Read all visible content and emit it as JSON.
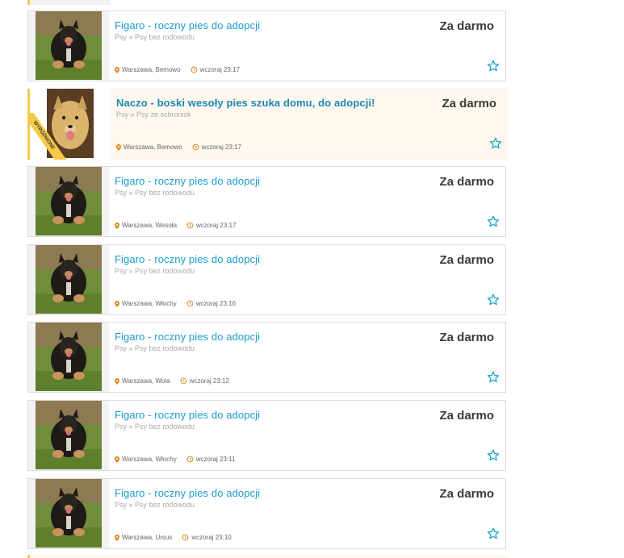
{
  "colors": {
    "title": "#1a9bd0",
    "price": "#3a3a3a",
    "accent": "#f7c948",
    "star": "#1aa5c8",
    "meta_icon": "#e08a1e"
  },
  "listings": [
    {
      "title": "Figaro - roczny pies do adopcji",
      "category": "Psy » Psy bez rodowodu",
      "price": "Za darmo",
      "location": "Warszawa, Bemowo",
      "time": "wczoraj 23:17",
      "featured": false,
      "image": "dog-photo-black-tan"
    },
    {
      "title": "Naczo - boski wesoły pies szuka domu, do adopcji!",
      "category": "Psy » Psy ze schronisk",
      "price": "Za darmo",
      "location": "Warszawa, Bemowo",
      "time": "wczoraj 23:17",
      "featured": true,
      "badge": "WYRÓŻNIONE",
      "image": "dog-photo-yellow"
    },
    {
      "title": "Figaro - roczny pies do adopcji",
      "category": "Psy » Psy bez rodowodu",
      "price": "Za darmo",
      "location": "Warszawa, Wesoła",
      "time": "wczoraj 23:17",
      "featured": false,
      "image": "dog-photo-black-tan"
    },
    {
      "title": "Figaro - roczny pies do adopcji",
      "category": "Psy » Psy bez rodowodu",
      "price": "Za darmo",
      "location": "Warszawa, Włochy",
      "time": "wczoraj 23:16",
      "featured": false,
      "image": "dog-photo-black-tan"
    },
    {
      "title": "Figaro - roczny pies do adopcji",
      "category": "Psy » Psy bez rodowodu",
      "price": "Za darmo",
      "location": "Warszawa, Wola",
      "time": "wczoraj 23:12",
      "featured": false,
      "image": "dog-photo-black-tan"
    },
    {
      "title": "Figaro - roczny pies do adopcji",
      "category": "Psy » Psy bez rodowodu",
      "price": "Za darmo",
      "location": "Warszawa, Włochy",
      "time": "wczoraj 23:11",
      "featured": false,
      "image": "dog-photo-black-tan"
    },
    {
      "title": "Figaro - roczny pies do adopcji",
      "category": "Psy » Psy bez rodowodu",
      "price": "Za darmo",
      "location": "Warszawa, Ursus",
      "time": "wczoraj 23:10",
      "featured": false,
      "image": "dog-photo-black-tan"
    }
  ]
}
